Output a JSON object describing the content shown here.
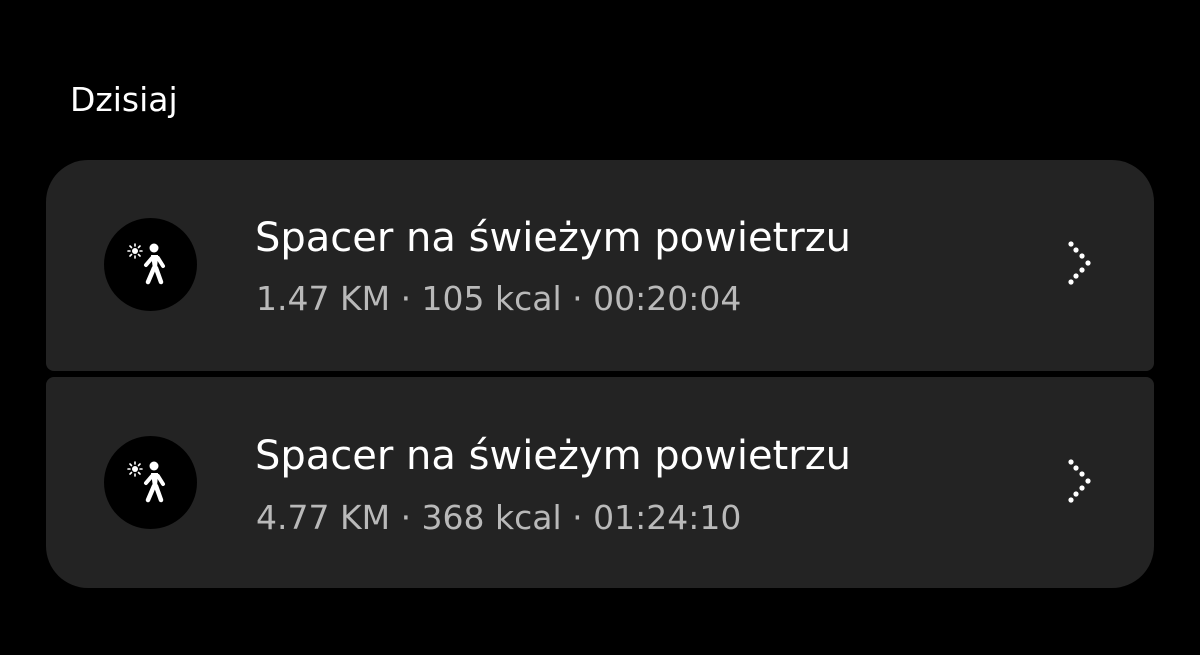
{
  "section": {
    "title": "Dzisiaj"
  },
  "activities": [
    {
      "icon": "walking-outdoor-icon",
      "title": "Spacer na świeżym powietrzu",
      "stats": "1.47 KM · 105 kcal · 00:20:04",
      "distance": "1.47 KM",
      "calories": "105 kcal",
      "duration": "00:20:04"
    },
    {
      "icon": "walking-outdoor-icon",
      "title": "Spacer na świeżym powietrzu",
      "stats": "4.77 KM · 368 kcal · 01:24:10",
      "distance": "4.77 KM",
      "calories": "368 kcal",
      "duration": "01:24:10"
    }
  ],
  "colors": {
    "background": "#000000",
    "card": "#232323",
    "primary_text": "#ffffff",
    "secondary_text": "#b9b9b9"
  }
}
